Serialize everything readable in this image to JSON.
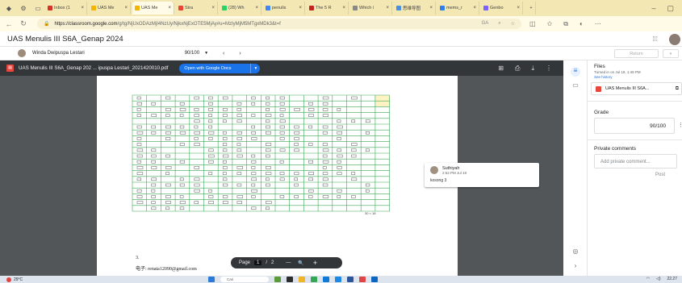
{
  "browser": {
    "tabs": [
      {
        "label": "Inbox (1",
        "color": "#d93025"
      },
      {
        "label": "UAS Me",
        "color": "#f4b400"
      },
      {
        "label": "UAS Me",
        "color": "#f4b400",
        "active": true
      },
      {
        "label": "Stra",
        "color": "#ea4335"
      },
      {
        "label": "(28) Wh",
        "color": "#25d366"
      },
      {
        "label": "penulis",
        "color": "#4285f4"
      },
      {
        "label": "The 5 R",
        "color": "#c5221f"
      },
      {
        "label": "Which i",
        "color": "#888888"
      },
      {
        "label": "思维导图",
        "color": "#4a90e2"
      },
      {
        "label": "mems_r",
        "color": "#2f80ed"
      },
      {
        "label": "Genbo",
        "color": "#7b61ff"
      }
    ],
    "new_tab": "+",
    "url_host": "https://classroom.google.com",
    "url_path": "/g/tg/NjUxODAzMjI4NzUy/NjkxNjExOTE5MjAy#u=MzIyMjM5MTgxMDk3&t=f",
    "zoom_badge": "GA"
  },
  "classroom": {
    "title": "UAS Menulis III S6A_Genap 2024",
    "student_name": "Winda Dwipuspa Lestari",
    "grade": "90/100",
    "return_label": "Return"
  },
  "viewer": {
    "filename": "UAS Menulis III S6A_Genap 202 ... ipuspa Lestari_2021420010.pdf",
    "open_with": "Open with Google Docs",
    "page1_footer": "30 × 18",
    "page2_line1": "3.",
    "page2_line2": "电子: renata12090@gmail.com",
    "page_label": "Page",
    "page_current": "1",
    "page_sep": "/",
    "page_total": "2"
  },
  "comment": {
    "author": "Suthiyah",
    "time": "2:52 PM Jul 19",
    "text": "kosong 3"
  },
  "panel": {
    "files_title": "Files",
    "turned_in": "Turned in on Jul 19, 1:49 PM",
    "see_history": "See history",
    "file_name": "UAS Menulis III S6A...",
    "grade_title": "Grade",
    "grade_value": "90/100",
    "private_title": "Private comments",
    "private_placeholder": "Add private comment...",
    "post_label": "Post"
  },
  "taskbar": {
    "temp": "29°C",
    "search_label": "Cari",
    "time": "22.27"
  }
}
